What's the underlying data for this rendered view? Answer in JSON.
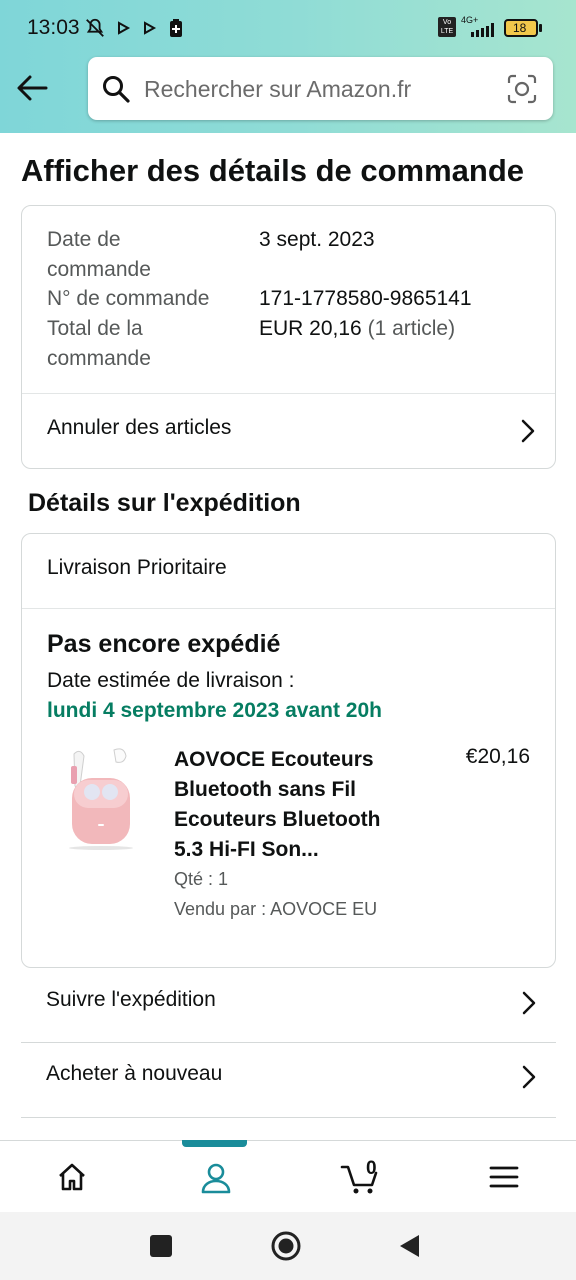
{
  "status_bar": {
    "time": "13:03",
    "network": "4G+",
    "volte": "Vo LTE",
    "battery": "18"
  },
  "header": {
    "search_placeholder": "Rechercher sur Amazon.fr"
  },
  "page_title": "Afficher des détails de commande",
  "order_summary": {
    "date_label": "Date de commande",
    "date_value": "3 sept. 2023",
    "number_label": "N° de commande",
    "number_value": "171-1778580-9865141",
    "total_label": "Total de la commande",
    "total_value": "EUR 20,16",
    "total_items": "(1 article)",
    "cancel_label": "Annuler des articles"
  },
  "shipment": {
    "section_title": "Détails sur l'expédition",
    "shipping_type": "Livraison Prioritaire",
    "status": "Pas encore expédié",
    "estimate_label": "Date estimée de livraison :",
    "estimate_date": "lundi 4 septembre 2023 avant 20h",
    "product": {
      "title": "AOVOCE Ecouteurs Bluetooth sans Fil Ecouteurs Bluetooth 5.3 Hi-FI Son...",
      "price": "€20,16",
      "qty": "Qté : 1",
      "seller": "Vendu par : AOVOCE EU"
    }
  },
  "actions": {
    "track": "Suivre l'expédition",
    "buy_again": "Acheter à nouveau"
  },
  "bottom_nav": {
    "cart_count": "0",
    "active": "account"
  },
  "colors": {
    "accent_green": "#067d62",
    "nav_indicator": "#1a8c9a",
    "header_gradient_start": "#7fd6d8",
    "header_gradient_end": "#a7e5cf"
  }
}
